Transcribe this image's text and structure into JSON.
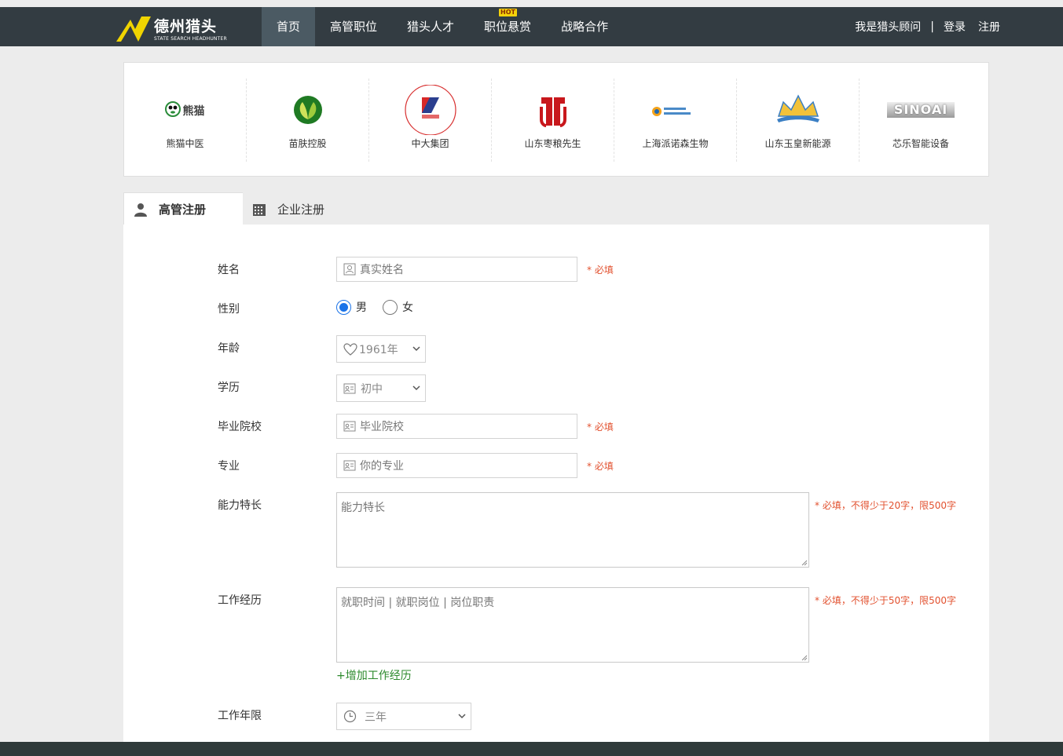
{
  "header": {
    "logo_text": "德州猎头",
    "logo_sub": "STATE SEARCH HEADHUNTER",
    "nav": [
      {
        "label": "首页",
        "active": true
      },
      {
        "label": "高管职位"
      },
      {
        "label": "猎头人才"
      },
      {
        "label": "职位悬赏",
        "badge": "HOT"
      },
      {
        "label": "战略合作"
      }
    ],
    "consultant": "我是猎头顾问",
    "separator": "|",
    "login": "登录",
    "register": "注册"
  },
  "partners": [
    {
      "name": "熊猫中医",
      "mark": "熊猫"
    },
    {
      "name": "苗肤控股"
    },
    {
      "name": "中大集团"
    },
    {
      "name": "山东枣粮先生"
    },
    {
      "name": "上海派诺森生物"
    },
    {
      "name": "山东玉皇新能源"
    },
    {
      "name": "芯乐智能设备",
      "mark": "SINOAI"
    }
  ],
  "tabs": [
    {
      "label": "高管注册",
      "active": true
    },
    {
      "label": "企业注册"
    }
  ],
  "form": {
    "name_label": "姓名",
    "name_placeholder": "真实姓名",
    "required": "* 必填",
    "gender_label": "性别",
    "gender_male": "男",
    "gender_female": "女",
    "age_label": "年龄",
    "age_value": "1961年",
    "edu_label": "学历",
    "edu_value": "初中",
    "school_label": "毕业院校",
    "school_placeholder": "毕业院校",
    "major_label": "专业",
    "major_placeholder": "你的专业",
    "skill_label": "能力特长",
    "skill_placeholder": "能力特长",
    "skill_hint": "* 必填，不得少于20字，限500字",
    "exp_label": "工作经历",
    "exp_placeholder": "就职时间 | 就职岗位 | 岗位职责",
    "exp_hint": "* 必填，不得少于50字，限500字",
    "add_exp": "+增加工作经历",
    "years_label": "工作年限",
    "years_value": "三年"
  }
}
